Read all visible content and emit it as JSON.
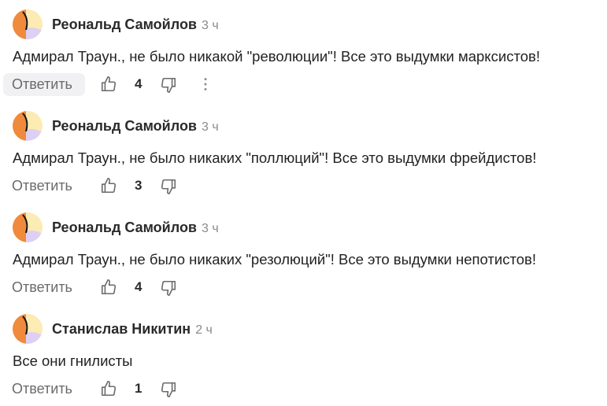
{
  "comments": [
    {
      "author": "Реональд Самойлов",
      "time": "3 ч",
      "text": "Адмирал Траун., не было никакой \"революции\"! Все это выдумки марксистов!",
      "reply_label": "Ответить",
      "likes": "4",
      "reply_active": true,
      "show_more": true
    },
    {
      "author": "Реональд Самойлов",
      "time": "3 ч",
      "text": "Адмирал Траун., не было никаких \"поллюций\"! Все это выдумки фрейдистов!",
      "reply_label": "Ответить",
      "likes": "3",
      "reply_active": false,
      "show_more": false
    },
    {
      "author": "Реональд Самойлов",
      "time": "3 ч",
      "text": "Адмирал Траун., не было никаких \"резолюций\"! Все это выдумки непотистов!",
      "reply_label": "Ответить",
      "likes": "4",
      "reply_active": false,
      "show_more": false
    },
    {
      "author": "Станислав Никитин",
      "time": "2 ч",
      "text": "Все они гнилисты",
      "reply_label": "Ответить",
      "likes": "1",
      "reply_active": false,
      "show_more": false
    }
  ],
  "avatar_colors": {
    "orange": "#f08a3c",
    "cream": "#fdebb4",
    "lilac": "#ddd0f4",
    "black": "#111111"
  },
  "icons": {
    "like": "thumbs-up-icon",
    "dislike": "thumbs-down-icon",
    "more": "more-vertical-icon"
  }
}
